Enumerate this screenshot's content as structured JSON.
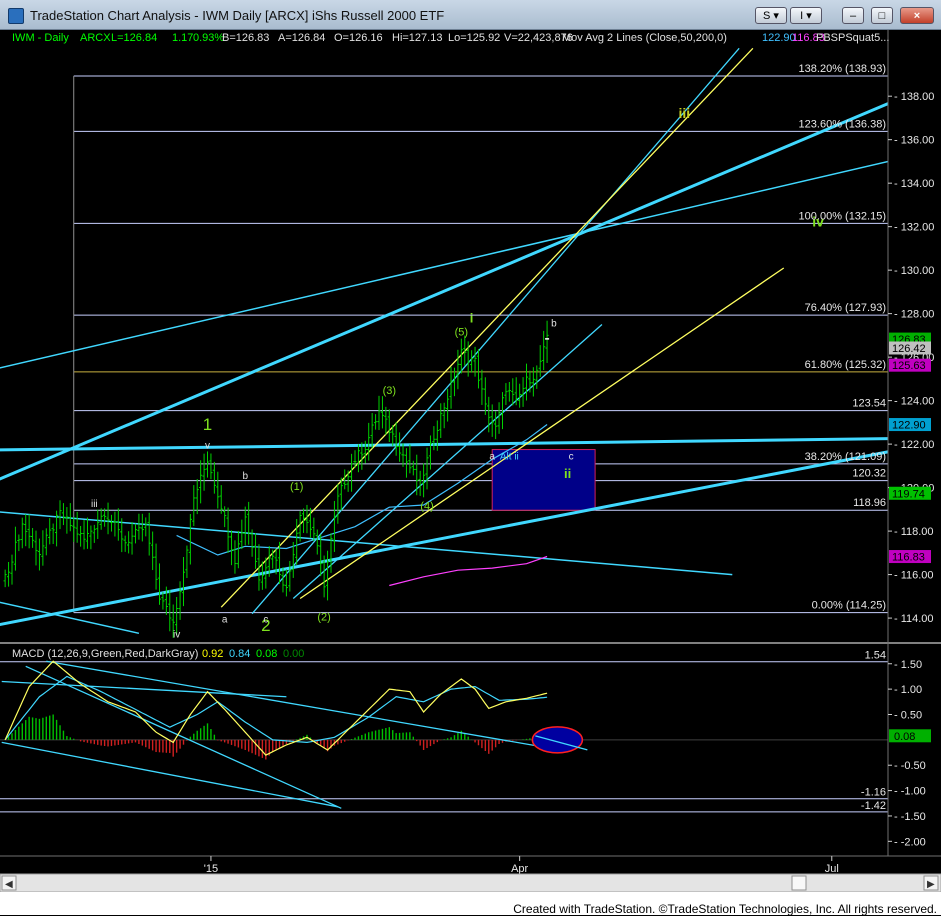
{
  "window": {
    "title": "TradeStation Chart Analysis - IWM Daily [ARCX] iShs Russell 2000 ETF",
    "controls": [
      "S",
      "I",
      "–",
      "□",
      "×"
    ]
  },
  "footer": {
    "credit": "Created with TradeStation. ©TradeStation Technologies, Inc. All rights reserved."
  },
  "colors": {
    "background": "#000000",
    "price_bars": "#00d200",
    "fib_lines": "#c8d0ff",
    "trend_lines": "#40d8ff",
    "wave_labels": "#7ee01e",
    "macd_line": "#00ff00",
    "signal_line": "#ff4040",
    "target_box": "#000088",
    "ma50": "#40c0ff",
    "ma200": "#ff40ff",
    "yellow_channel": "#ffff60"
  },
  "chart_data": {
    "type": "candlestick",
    "symbol": "IWM - Daily",
    "header": {
      "symbol": "IWM - Daily",
      "exchange": "ARCX",
      "last": "L=126.84",
      "change": "1.17",
      "change_pct": "0.93%",
      "bid": "B=126.83",
      "ask": "A=126.84",
      "open": "O=126.16",
      "high": "Hi=127.13",
      "low": "Lo=125.92",
      "volume": "V=22,423,876",
      "study": "Mov Avg 2 Lines (Close,50,200,0)",
      "ma_values": [
        "122.90",
        "116.83"
      ],
      "extra": "PBSPSquat5..."
    },
    "x_tick_labels": [
      {
        "label": "'15",
        "day": 58
      },
      {
        "label": "Apr",
        "day": 148
      },
      {
        "label": "Jul",
        "day": 239
      }
    ],
    "price_axis": {
      "ylim": [
        112.9,
        140.4
      ],
      "ticks": [
        114.0,
        116.0,
        118.0,
        120.0,
        122.0,
        124.0,
        126.0,
        128.0,
        130.0,
        132.0,
        134.0,
        136.0,
        138.0
      ]
    },
    "price_badges": [
      {
        "label": "126.83",
        "value": 126.83,
        "color": "#00b000"
      },
      {
        "label": "126.42",
        "value": 126.42,
        "color": "#c0c0c0"
      },
      {
        "label": "125.63",
        "value": 125.63,
        "color": "#c000c0"
      },
      {
        "label": "122.90",
        "value": 122.9,
        "color": "#00a0d0"
      },
      {
        "label": "119.74",
        "value": 119.74,
        "color": "#00c000"
      },
      {
        "label": "116.83",
        "value": 116.83,
        "color": "#c000c0"
      }
    ],
    "fib_levels": [
      {
        "label": "138.20% (138.93)",
        "value": 138.93
      },
      {
        "label": "123.60% (136.38)",
        "value": 136.38
      },
      {
        "label": "100.00% (132.15)",
        "value": 132.15
      },
      {
        "label": "76.40% (127.93)",
        "value": 127.93
      },
      {
        "label": "61.80% (125.32)",
        "value": 125.32,
        "color": "#c8b040"
      },
      {
        "label": "123.54",
        "value": 123.54
      },
      {
        "label": "38.20% (121.09)",
        "value": 121.09
      },
      {
        "label": "120.32",
        "value": 120.32
      },
      {
        "label": "118.96",
        "value": 118.96
      },
      {
        "label": "0.00% (114.25)",
        "value": 114.25
      }
    ],
    "target_box": {
      "day_start": 140,
      "day_end": 170,
      "price_low": 118.96,
      "price_high": 121.75
    },
    "trend_lines": [
      {
        "from": [
          -20,
          119.3
        ],
        "to": [
          280,
          139.3
        ],
        "width": 3,
        "color": "#40d8ff"
      },
      {
        "from": [
          -20,
          113.2
        ],
        "to": [
          280,
          122.4
        ],
        "width": 3,
        "color": "#40d8ff"
      },
      {
        "from": [
          -20,
          121.7
        ],
        "to": [
          280,
          122.3
        ],
        "width": 3,
        "color": "#40d8ff"
      },
      {
        "from": [
          -20,
          124.9
        ],
        "to": [
          280,
          135.9
        ],
        "width": 1.5,
        "color": "#40d8ff"
      },
      {
        "from": [
          -20,
          119.1
        ],
        "to": [
          210,
          116.0
        ],
        "width": 1.5,
        "color": "#40d8ff"
      },
      {
        "from": [
          -20,
          115.3
        ],
        "to": [
          37,
          113.3
        ],
        "width": 1.5,
        "color": "#40d8ff"
      },
      {
        "from": [
          82,
          114.9
        ],
        "to": [
          172,
          127.5
        ],
        "width": 1.3,
        "color": "#40d8ff"
      },
      {
        "from": [
          70,
          114.2
        ],
        "to": [
          212,
          140.2
        ],
        "width": 1.3,
        "color": "#40d8ff"
      },
      {
        "from": [
          61,
          114.5
        ],
        "to": [
          216,
          140.2
        ],
        "width": 1.3,
        "color": "#ffff60"
      },
      {
        "from": [
          84,
          114.9
        ],
        "to": [
          225,
          130.1
        ],
        "width": 1.3,
        "color": "#ffff60"
      }
    ],
    "wave_labels": [
      {
        "text": "1",
        "day": 57,
        "price": 122.65,
        "size": 17,
        "color": "#7ee01e"
      },
      {
        "text": "2",
        "day": 74,
        "price": 113.4,
        "size": 17,
        "color": "#7ee01e"
      },
      {
        "text": "iii",
        "day": 196,
        "price": 137.0,
        "size": 14,
        "color": "#c8d020",
        "bold": true
      },
      {
        "text": "iv",
        "day": 235,
        "price": 132.0,
        "size": 14,
        "color": "#7ee01e",
        "bold": true
      },
      {
        "text": "i",
        "day": 134,
        "price": 127.6,
        "size": 13,
        "color": "#7ee01e",
        "bold": true
      },
      {
        "text": "ii",
        "day": 162,
        "price": 120.45,
        "size": 13,
        "color": "#7ee01e",
        "bold": true
      },
      {
        "text": "(1)",
        "day": 83,
        "price": 119.9,
        "size": 11,
        "color": "#7ee01e"
      },
      {
        "text": "(2)",
        "day": 91,
        "price": 113.9,
        "size": 11,
        "color": "#7ee01e"
      },
      {
        "text": "(3)",
        "day": 110,
        "price": 124.3,
        "size": 11,
        "color": "#7ee01e"
      },
      {
        "text": "(4)",
        "day": 121,
        "price": 119.0,
        "size": 11,
        "color": "#7ee01e"
      },
      {
        "text": "(5)",
        "day": 131,
        "price": 127.0,
        "size": 11,
        "color": "#7ee01e"
      },
      {
        "text": "iii",
        "day": 24,
        "price": 119.1,
        "size": 10,
        "color": "#e0e0e0"
      },
      {
        "text": "iv",
        "day": 48,
        "price": 113.1,
        "size": 10,
        "color": "#e0e0e0"
      },
      {
        "text": "v",
        "day": 57,
        "price": 121.8,
        "size": 10,
        "color": "#e0e0e0"
      },
      {
        "text": "a",
        "day": 62,
        "price": 113.8,
        "size": 10,
        "color": "#e0e0e0"
      },
      {
        "text": "b",
        "day": 68,
        "price": 120.4,
        "size": 10,
        "color": "#e0e0e0"
      },
      {
        "text": "c",
        "day": 74,
        "price": 113.8,
        "size": 10,
        "color": "#e0e0e0"
      },
      {
        "text": "a",
        "day": 140,
        "price": 121.3,
        "size": 10,
        "color": "#e0e0e0"
      },
      {
        "text": "b",
        "day": 158,
        "price": 127.4,
        "size": 10,
        "color": "#e0e0e0"
      },
      {
        "text": "c",
        "day": 163,
        "price": 121.3,
        "size": 10,
        "color": "#e0e0e0"
      },
      {
        "text": "Alt ii",
        "day": 145,
        "price": 121.3,
        "size": 10,
        "color": "#40d8ff"
      }
    ],
    "price_anchors": [
      [
        -2,
        115.8
      ],
      [
        3,
        118.3
      ],
      [
        8,
        117.0
      ],
      [
        14,
        118.8
      ],
      [
        21,
        117.6
      ],
      [
        27,
        118.9
      ],
      [
        33,
        117.5
      ],
      [
        39,
        118.2
      ],
      [
        43,
        115.0
      ],
      [
        47,
        113.8
      ],
      [
        50,
        116.2
      ],
      [
        53,
        119.5
      ],
      [
        57,
        121.3
      ],
      [
        61,
        119.2
      ],
      [
        65,
        116.7
      ],
      [
        68,
        118.7
      ],
      [
        72,
        115.9
      ],
      [
        76,
        117.0
      ],
      [
        80,
        115.3
      ],
      [
        84,
        118.9
      ],
      [
        88,
        117.9
      ],
      [
        91,
        115.6
      ],
      [
        95,
        119.5
      ],
      [
        99,
        121.1
      ],
      [
        103,
        121.9
      ],
      [
        107,
        123.5
      ],
      [
        111,
        122.4
      ],
      [
        115,
        121.2
      ],
      [
        119,
        120.1
      ],
      [
        123,
        122.4
      ],
      [
        127,
        124.2
      ],
      [
        131,
        126.2
      ],
      [
        135,
        125.8
      ],
      [
        138,
        123.7
      ],
      [
        141,
        122.7
      ],
      [
        144,
        124.6
      ],
      [
        147,
        123.9
      ],
      [
        150,
        124.9
      ],
      [
        153,
        125.3
      ],
      [
        156,
        126.8
      ]
    ],
    "ma50_anchors": [
      [
        48,
        117.8
      ],
      [
        60,
        116.9
      ],
      [
        68,
        117.3
      ],
      [
        80,
        117.2
      ],
      [
        90,
        117.7
      ],
      [
        100,
        118.2
      ],
      [
        110,
        119.1
      ],
      [
        120,
        119.2
      ],
      [
        130,
        120.2
      ],
      [
        140,
        121.3
      ],
      [
        150,
        122.2
      ],
      [
        156,
        122.9
      ]
    ],
    "ma200_anchors": [
      [
        110,
        115.5
      ],
      [
        120,
        115.9
      ],
      [
        130,
        116.2
      ],
      [
        140,
        116.3
      ],
      [
        150,
        116.5
      ],
      [
        156,
        116.83
      ]
    ],
    "macd": {
      "header": {
        "name": "MACD (12,26,9,Green,Red,DarkGray)",
        "macd": "0.92",
        "signal": "0.84",
        "hist": "0.08",
        "zero": "0.00"
      },
      "ylim": [
        -2.25,
        1.85
      ],
      "ticks": [
        1.5,
        1.0,
        0.5,
        -0.5,
        -1.0,
        -1.5,
        -2.0
      ],
      "levels": [
        {
          "label": "1.54",
          "value": 1.54
        },
        {
          "label": "-1.16",
          "value": -1.16
        },
        {
          "label": "-1.42",
          "value": -1.42
        }
      ],
      "zero_badge": "0.08",
      "macd_anchors": [
        [
          -2,
          0.0
        ],
        [
          5,
          1.05
        ],
        [
          12,
          1.55
        ],
        [
          20,
          1.1
        ],
        [
          28,
          0.75
        ],
        [
          36,
          0.55
        ],
        [
          42,
          0.15
        ],
        [
          47,
          -0.05
        ],
        [
          52,
          0.5
        ],
        [
          57,
          0.95
        ],
        [
          62,
          0.6
        ],
        [
          68,
          0.15
        ],
        [
          74,
          -0.3
        ],
        [
          80,
          -0.1
        ],
        [
          86,
          0.05
        ],
        [
          92,
          -0.2
        ],
        [
          98,
          0.2
        ],
        [
          104,
          0.6
        ],
        [
          110,
          1.0
        ],
        [
          116,
          0.95
        ],
        [
          120,
          0.55
        ],
        [
          125,
          0.9
        ],
        [
          131,
          1.2
        ],
        [
          135,
          1.0
        ],
        [
          139,
          0.62
        ],
        [
          144,
          0.75
        ],
        [
          150,
          0.82
        ],
        [
          156,
          0.92
        ]
      ],
      "signal_anchors": [
        [
          -2,
          0.0
        ],
        [
          8,
          0.85
        ],
        [
          16,
          1.25
        ],
        [
          26,
          0.95
        ],
        [
          36,
          0.6
        ],
        [
          46,
          0.25
        ],
        [
          54,
          0.5
        ],
        [
          60,
          0.75
        ],
        [
          68,
          0.35
        ],
        [
          76,
          0.0
        ],
        [
          86,
          -0.05
        ],
        [
          94,
          0.05
        ],
        [
          104,
          0.45
        ],
        [
          112,
          0.85
        ],
        [
          120,
          0.75
        ],
        [
          128,
          1.0
        ],
        [
          135,
          1.05
        ],
        [
          142,
          0.78
        ],
        [
          150,
          0.8
        ],
        [
          156,
          0.84
        ]
      ],
      "trend_lines": [
        {
          "from": [
            -3,
            -0.05
          ],
          "to": [
            95,
            -1.32
          ]
        },
        {
          "from": [
            4,
            1.45
          ],
          "to": [
            96,
            -1.35
          ]
        },
        {
          "from": [
            10,
            1.55
          ],
          "to": [
            160,
            -0.2
          ]
        },
        {
          "from": [
            -3,
            1.15
          ],
          "to": [
            80,
            0.85
          ]
        }
      ],
      "ellipse": {
        "day": 159,
        "value": 0.0
      }
    }
  }
}
